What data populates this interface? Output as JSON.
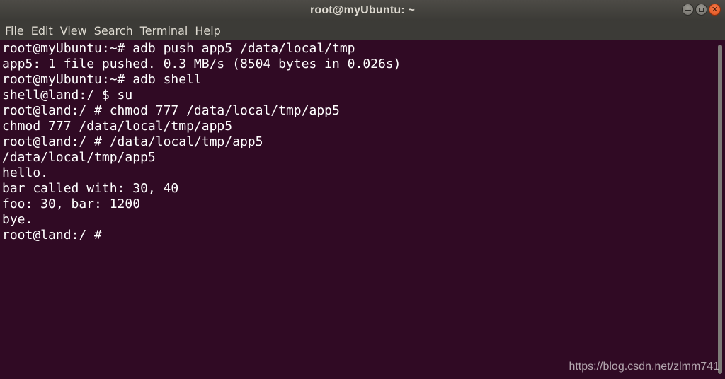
{
  "window": {
    "title": "root@myUbuntu: ~"
  },
  "menu": {
    "items": [
      "File",
      "Edit",
      "View",
      "Search",
      "Terminal",
      "Help"
    ]
  },
  "terminal": {
    "lines": [
      "root@myUbuntu:~# adb push app5 /data/local/tmp",
      "app5: 1 file pushed. 0.3 MB/s (8504 bytes in 0.026s)",
      "root@myUbuntu:~# adb shell",
      "shell@land:/ $ su",
      "root@land:/ # chmod 777 /data/local/tmp/app5",
      "chmod 777 /data/local/tmp/app5",
      "root@land:/ # /data/local/tmp/app5",
      "/data/local/tmp/app5",
      "hello.",
      "bar called with: 30, 40",
      "foo: 30, bar: 1200",
      "bye.",
      "root@land:/ # "
    ]
  },
  "watermark": "https://blog.csdn.net/zlmm741",
  "colors": {
    "terminal_bg": "#300a24",
    "text": "#ffffff",
    "menubar_bg": "#3c3b37",
    "close_button": "#e95420"
  }
}
